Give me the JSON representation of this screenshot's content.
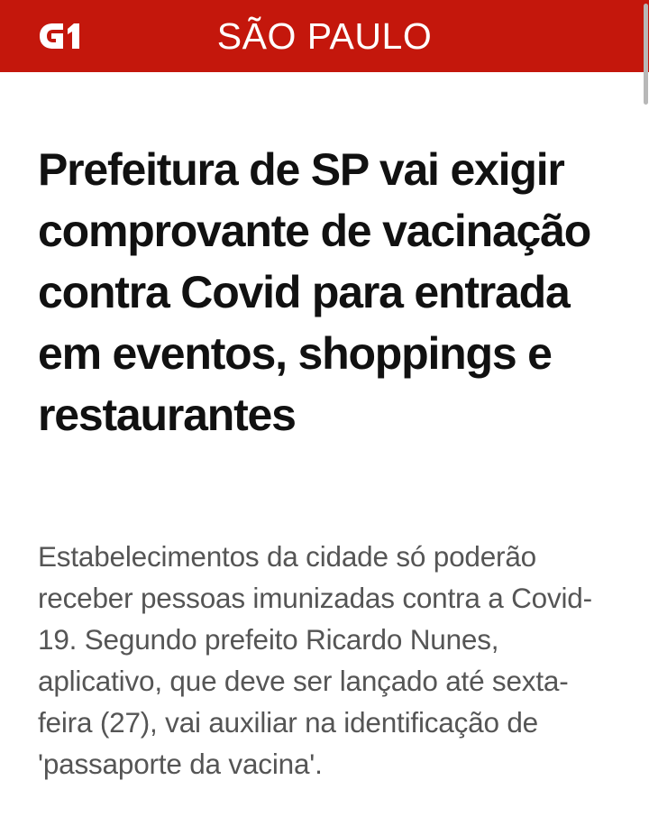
{
  "header": {
    "logo_text": "G1",
    "section_title": "SÃO PAULO",
    "colors": {
      "bar": "#c4170c",
      "text": "#ffffff"
    }
  },
  "article": {
    "headline": "Prefeitura de SP vai exigir comprovante de vacinação contra Covid para entrada em eventos, shoppings e restaurantes",
    "subheadline": "Estabelecimentos da cidade só poderão receber pessoas imunizadas contra a Covid-19. Segundo prefeito Ricardo Nunes, aplicativo, que deve ser lançado até sexta-feira (27), vai auxiliar na identificação de 'passaporte da vacina'."
  }
}
